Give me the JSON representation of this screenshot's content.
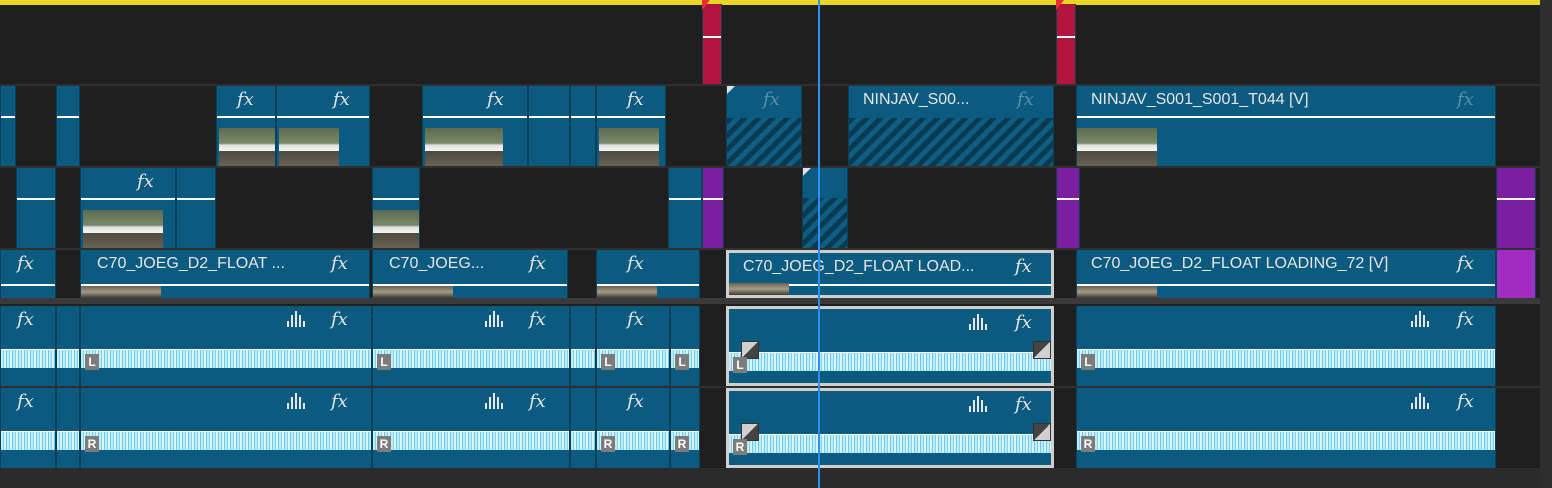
{
  "timeline": {
    "video_clips": [
      {
        "id": "v2-ninjav-1",
        "name": "NINJAV_S00...",
        "fx": "fx"
      },
      {
        "id": "v2-ninjav-2",
        "name": "NINJAV_S001_S001_T044 [V]",
        "fx": "fx"
      },
      {
        "id": "v1-c70-1",
        "name": "C70_JOEG_D2_FLOAT ...",
        "fx": "fx"
      },
      {
        "id": "v1-c70-2",
        "name": "C70_JOEG...",
        "fx": "fx"
      },
      {
        "id": "v1-c70-3",
        "name": "C70_JOEG_D2_FLOAT LOAD...",
        "fx": "fx"
      },
      {
        "id": "v1-c70-4",
        "name": "C70_JOEG_D2_FLOAT LOADING_72 [V]",
        "fx": "fx"
      }
    ],
    "fx_label": "fx",
    "audio_channels": {
      "left": "L",
      "right": "R"
    },
    "colors": {
      "video_clip": "#0b5a7f",
      "audio_waveform": "#bfeeff",
      "playhead": "#2d8ff0",
      "work_area_bar": "#e8d825",
      "adjustment_layer": "#7a1fa0",
      "marker": "#b3143c",
      "selection": "#cfcfcf"
    },
    "icons": [
      "fx-badge-icon",
      "audio-waveform-icon",
      "keyframe-icon",
      "playhead-icon",
      "in-point-marker-icon"
    ]
  }
}
